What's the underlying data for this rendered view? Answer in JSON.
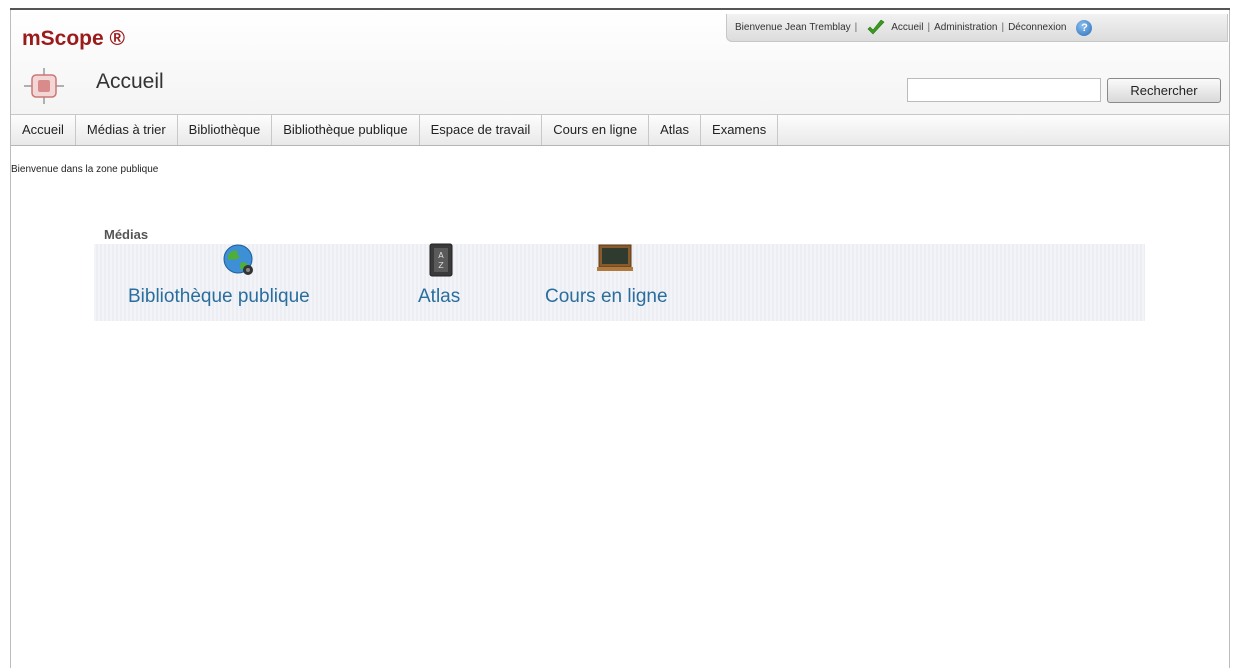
{
  "brand": {
    "name": "mScope ®"
  },
  "user_bar": {
    "welcome": "Bienvenue Jean Tremblay",
    "links": [
      "Accueil",
      "Administration",
      "Déconnexion"
    ]
  },
  "page": {
    "title": "Accueil"
  },
  "search": {
    "value": "",
    "button_label": "Rechercher"
  },
  "nav": {
    "tabs": [
      "Accueil",
      "Médias à trier",
      "Bibliothèque",
      "Bibliothèque publique",
      "Espace de travail",
      "Cours en ligne",
      "Atlas",
      "Examens"
    ]
  },
  "content": {
    "welcome_text": "Bienvenue dans la zone publique",
    "media_section": {
      "label": "Médias",
      "items": [
        {
          "label": "Bibliothèque publique",
          "icon": "globe-icon"
        },
        {
          "label": "Atlas",
          "icon": "atlas-book-icon"
        },
        {
          "label": "Cours en ligne",
          "icon": "chalkboard-icon"
        }
      ]
    }
  },
  "colors": {
    "brand": "#9b1b1b",
    "link": "#2a6e9e",
    "check": "#3a9a1e",
    "help": "#2a6db8"
  }
}
